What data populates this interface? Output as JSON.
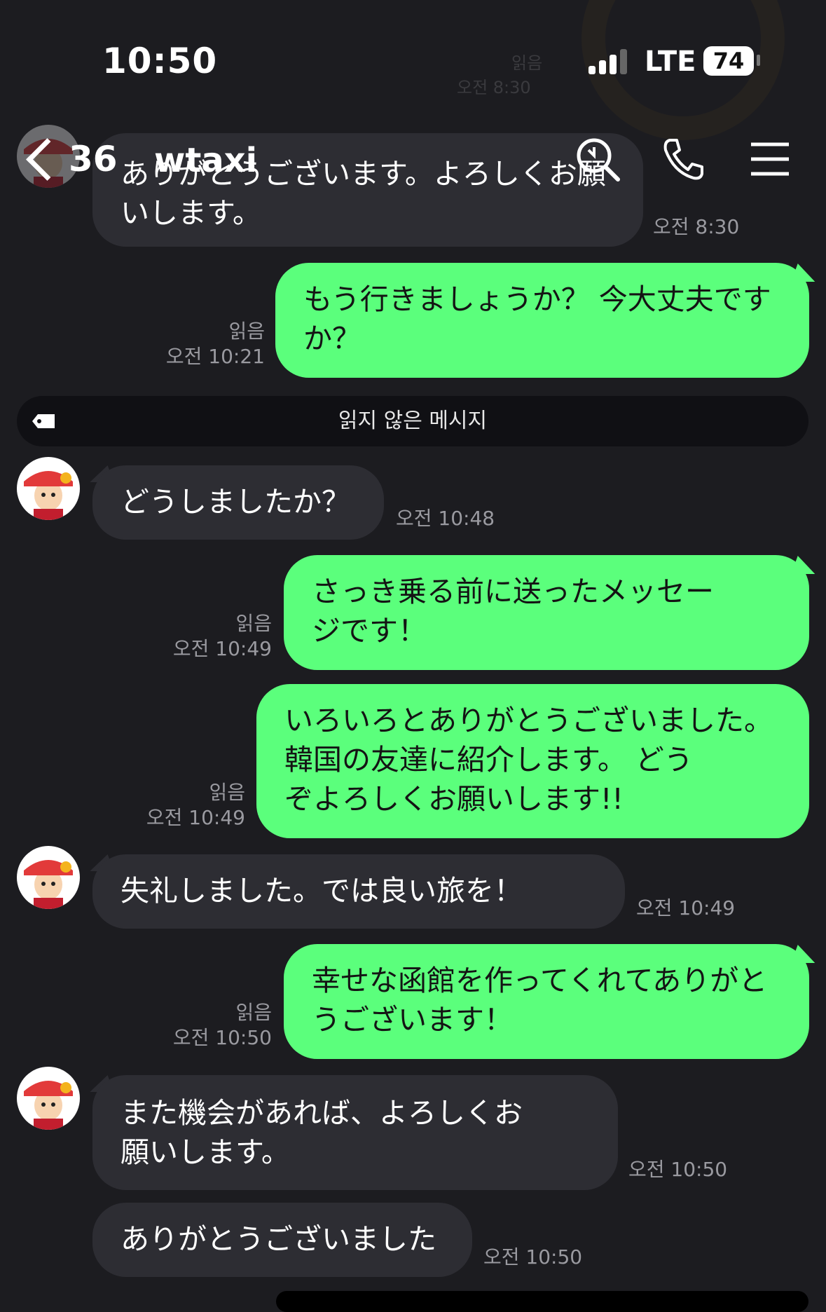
{
  "status": {
    "time": "10:50",
    "network": "LTE",
    "battery": "74"
  },
  "header": {
    "back_count": "36",
    "title": "wtaxi",
    "icons": [
      "search-icon",
      "phone-icon",
      "menu-icon"
    ]
  },
  "ghost": {
    "read": "읽음",
    "time": "오전 8:30"
  },
  "messages": [
    {
      "side": "in",
      "text": "ありがとうございます。よろしくお願いします。",
      "time": "오전 8:30"
    },
    {
      "side": "out",
      "line1": "もう行きましょうか？ 今大丈夫です",
      "line2": "か？",
      "read": "읽음",
      "time": "오전 10:21"
    },
    {
      "side": "in",
      "text": "どうしましたか？",
      "time": "오전 10:48"
    },
    {
      "side": "out",
      "line1": "さっき乗る前に送ったメッセー",
      "line2": "ジです！",
      "read": "읽음",
      "time": "오전 10:49"
    },
    {
      "side": "out",
      "line1": "いろいろとありがとうございました。",
      "line2": "韓国の友達に紹介します。 どう",
      "line3": "ぞよろしくお願いします!!",
      "read": "읽음",
      "time": "오전 10:49"
    },
    {
      "side": "in",
      "text": "失礼しました。では良い旅を！",
      "time": "오전 10:49"
    },
    {
      "side": "out",
      "line1": "幸せな函館を作ってくれてありがと",
      "line2": "うございます！",
      "read": "읽음",
      "time": "오전 10:50"
    },
    {
      "side": "in",
      "line1": "また機会があれば、よろしくお",
      "line2": "願いします。",
      "time": "오전 10:50"
    },
    {
      "side": "in",
      "text": "ありがとうございました",
      "time": "오전 10:50"
    }
  ],
  "unread_divider": "읽지 않은 메시지",
  "colors": {
    "background": "#1c1c20",
    "outgoing_bubble": "#5bff7c",
    "incoming_bubble": "#2d2d33"
  }
}
